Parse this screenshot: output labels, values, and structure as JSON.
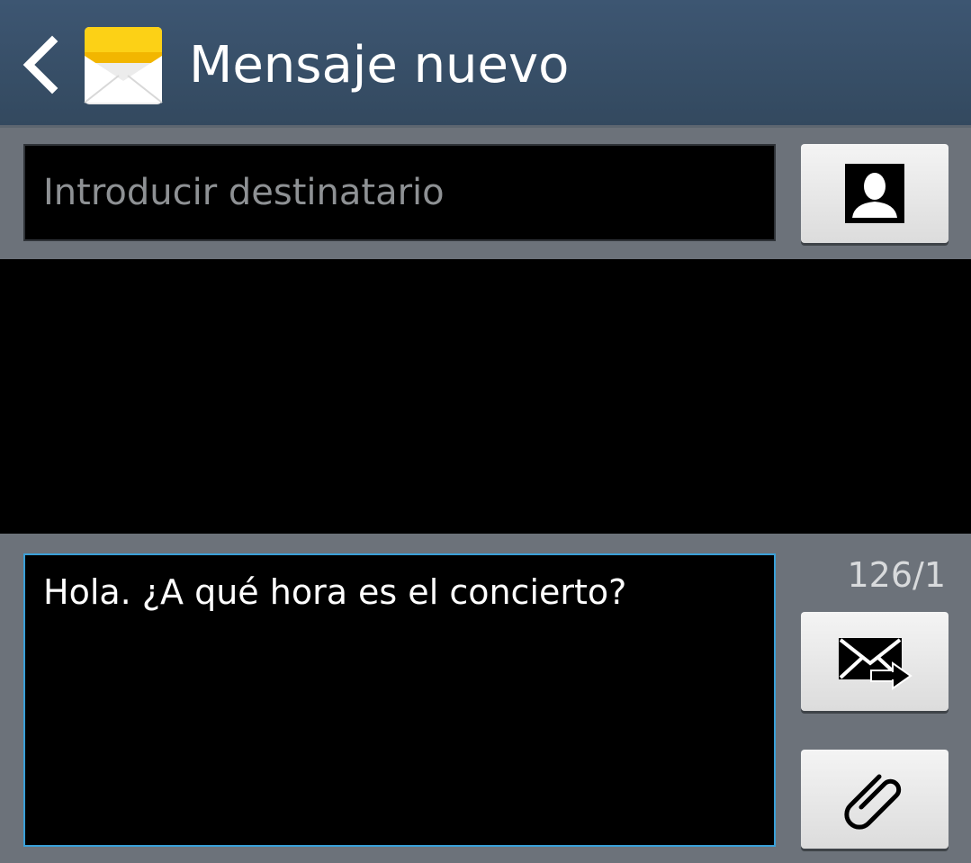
{
  "header": {
    "title": "Mensaje nuevo",
    "back_icon": "chevron-left-icon",
    "app_icon": "envelope-icon"
  },
  "recipient": {
    "placeholder": "Introducir destinatario",
    "value": "",
    "contact_icon": "contact-icon"
  },
  "compose": {
    "message": "Hola. ¿A qué hora es el concierto?",
    "counter": "126/1",
    "send_icon": "send-message-icon",
    "attach_icon": "paperclip-icon"
  },
  "colors": {
    "header_bg": "#3a5069",
    "bar_bg": "#6c727a",
    "focus_border": "#3aa0d8",
    "icon_yellow": "#fcd116"
  }
}
